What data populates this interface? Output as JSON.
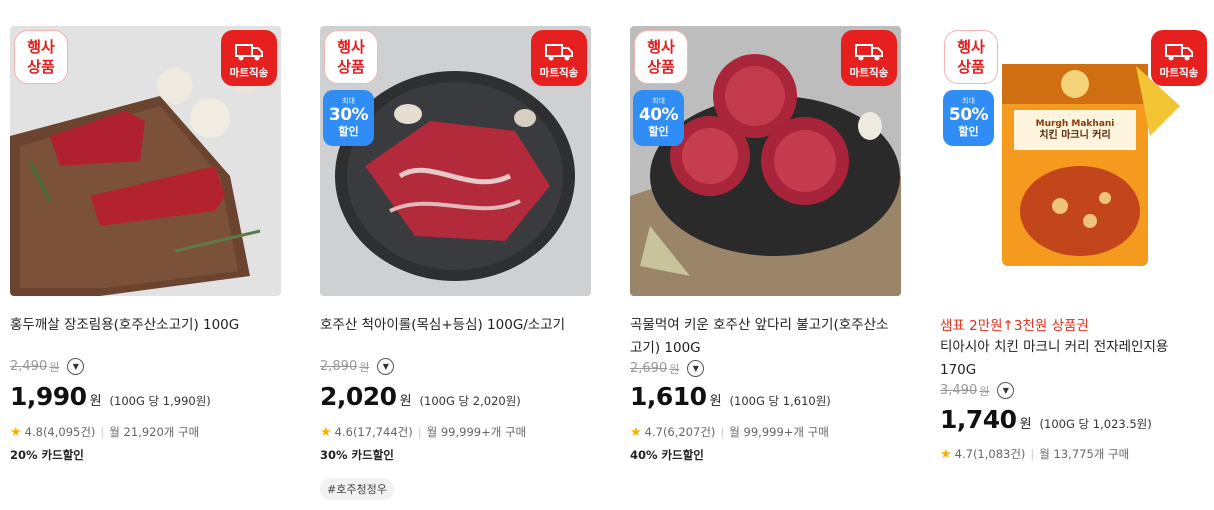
{
  "products": [
    {
      "event_badge": [
        "행사",
        "상품"
      ],
      "mart_badge": "마트직송",
      "discount_badge": null,
      "promo": "",
      "title": "홍두깨살 장조림용(호주산소고기) 100G",
      "original_price": "2,490",
      "original_won": "원",
      "price": "1,990",
      "price_won": "원",
      "unit_price": "(100G 당 1,990원)",
      "rating": "4.8(4,095건)",
      "monthly": "월 21,920개 구매",
      "card_discount": "20% 카드할인",
      "tag": ""
    },
    {
      "event_badge": [
        "행사",
        "상품"
      ],
      "mart_badge": "마트직송",
      "discount_badge": {
        "small": "최대",
        "pct": "30%",
        "label": "할인"
      },
      "promo": "",
      "title": "호주산 척아이롤(목심+등심) 100G/소고기",
      "original_price": "2,890",
      "original_won": "원",
      "price": "2,020",
      "price_won": "원",
      "unit_price": "(100G 당 2,020원)",
      "rating": "4.6(17,744건)",
      "monthly": "월 99,999+개 구매",
      "card_discount": "30% 카드할인",
      "tag": "#호주청정우"
    },
    {
      "event_badge": [
        "행사",
        "상품"
      ],
      "mart_badge": "마트직송",
      "discount_badge": {
        "small": "최대",
        "pct": "40%",
        "label": "할인"
      },
      "promo": "",
      "title": "곡물먹여 키운 호주산 앞다리 불고기(호주산소고기) 100G",
      "original_price": "2,690",
      "original_won": "원",
      "price": "1,610",
      "price_won": "원",
      "unit_price": "(100G 당 1,610원)",
      "rating": "4.7(6,207건)",
      "monthly": "월 99,999+개 구매",
      "card_discount": "40% 카드할인",
      "tag": ""
    },
    {
      "event_badge": [
        "행사",
        "상품"
      ],
      "mart_badge": "마트직송",
      "discount_badge": {
        "small": "최대",
        "pct": "50%",
        "label": "할인"
      },
      "promo": "샘표 2만원↑3천원 상품권",
      "title": "티아시아 치킨 마크니 커리 전자레인지용 170G",
      "original_price": "3,490",
      "original_won": "원",
      "price": "1,740",
      "price_won": "원",
      "unit_price": "(100G 당 1,023.5원)",
      "rating": "4.7(1,083건)",
      "monthly": "월 13,775개 구매",
      "card_discount": "",
      "tag": "",
      "package_text": [
        "Murgh Makhani",
        "치킨 마크니 커리"
      ]
    }
  ],
  "icons": {
    "mart": "truck-icon",
    "chevron": "chevron-down-icon",
    "star": "star-icon"
  },
  "colors": {
    "red": "#e61f1f",
    "blue": "#2f8df5",
    "promo_red": "#e0301e",
    "star": "#f5b301"
  }
}
